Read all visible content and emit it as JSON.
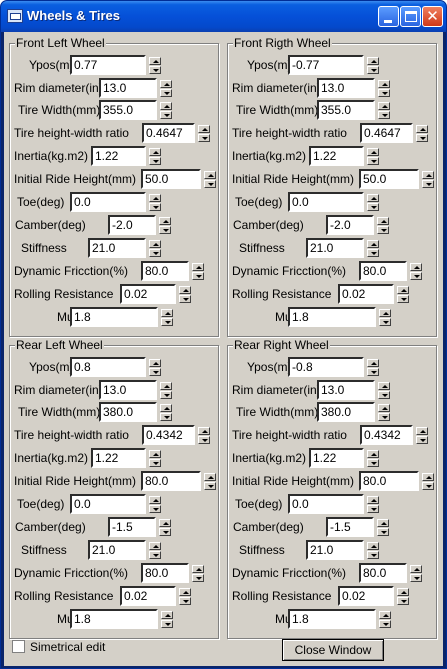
{
  "window": {
    "title": "Wheels & Tires",
    "icons": {
      "app": "window-app-icon",
      "minimize": "minimize-icon",
      "maximize": "maximize-icon",
      "close": "close-icon"
    }
  },
  "groups": {
    "front_left": {
      "title": "Front Left Wheel",
      "fields": {
        "ypos": {
          "label": "Ypos(m)",
          "value": "0.77"
        },
        "rim": {
          "label": "Rim diameter(in)",
          "value": "13.0"
        },
        "tire_width": {
          "label": "Tire Width(mm)",
          "value": "355.0"
        },
        "ratio": {
          "label": "Tire height-width ratio",
          "value": "0.4647"
        },
        "inertia": {
          "label": "Inertia(kg.m2)",
          "value": "1.22"
        },
        "ride_height": {
          "label": "Initial Ride Height(mm)",
          "value": "50.0"
        },
        "toe": {
          "label": "Toe(deg)",
          "value": "0.0"
        },
        "camber": {
          "label": "Camber(deg)",
          "value": "-2.0"
        },
        "stiffness": {
          "label": "Stiffness",
          "value": "21.0"
        },
        "friction": {
          "label": "Dynamic Fricction(%)",
          "value": "80.0"
        },
        "rolling": {
          "label": "Rolling Resistance",
          "value": "0.02"
        },
        "mu": {
          "label": "Mu",
          "value": "1.8"
        }
      }
    },
    "front_right": {
      "title": "Front Rigth Wheel",
      "fields": {
        "ypos": {
          "label": "Ypos(m)",
          "value": "-0.77"
        },
        "rim": {
          "label": "Rim diameter(in)",
          "value": "13.0"
        },
        "tire_width": {
          "label": "Tire Width(mm)",
          "value": "355.0"
        },
        "ratio": {
          "label": "Tire height-width ratio",
          "value": "0.4647"
        },
        "inertia": {
          "label": "Inertia(kg.m2)",
          "value": "1.22"
        },
        "ride_height": {
          "label": "Initial Ride Height(mm)",
          "value": "50.0"
        },
        "toe": {
          "label": "Toe(deg)",
          "value": "0.0"
        },
        "camber": {
          "label": "Camber(deg)",
          "value": "-2.0"
        },
        "stiffness": {
          "label": "Stiffness",
          "value": "21.0"
        },
        "friction": {
          "label": "Dynamic Fricction(%)",
          "value": "80.0"
        },
        "rolling": {
          "label": "Rolling Resistance",
          "value": "0.02"
        },
        "mu": {
          "label": "Mu",
          "value": "1.8"
        }
      }
    },
    "rear_left": {
      "title": "Rear Left Wheel",
      "fields": {
        "ypos": {
          "label": "Ypos(m)",
          "value": "0.8"
        },
        "rim": {
          "label": "Rim diameter(in)",
          "value": "13.0"
        },
        "tire_width": {
          "label": "Tire Width(mm)",
          "value": "380.0"
        },
        "ratio": {
          "label": "Tire height-width ratio",
          "value": "0.4342"
        },
        "inertia": {
          "label": "Inertia(kg.m2)",
          "value": "1.22"
        },
        "ride_height": {
          "label": "Initial Ride Height(mm)",
          "value": "80.0"
        },
        "toe": {
          "label": "Toe(deg)",
          "value": "0.0"
        },
        "camber": {
          "label": "Camber(deg)",
          "value": "-1.5"
        },
        "stiffness": {
          "label": "Stiffness",
          "value": "21.0"
        },
        "friction": {
          "label": "Dynamic Fricction(%)",
          "value": "80.0"
        },
        "rolling": {
          "label": "Rolling Resistance",
          "value": "0.02"
        },
        "mu": {
          "label": "Mu",
          "value": "1.8"
        }
      }
    },
    "rear_right": {
      "title": "Rear Right Wheel",
      "fields": {
        "ypos": {
          "label": "Ypos(m)",
          "value": "-0.8"
        },
        "rim": {
          "label": "Rim diameter(in)",
          "value": "13.0"
        },
        "tire_width": {
          "label": "Tire Width(mm)",
          "value": "380.0"
        },
        "ratio": {
          "label": "Tire height-width ratio",
          "value": "0.4342"
        },
        "inertia": {
          "label": "Inertia(kg.m2)",
          "value": "1.22"
        },
        "ride_height": {
          "label": "Initial Ride Height(mm)",
          "value": "80.0"
        },
        "toe": {
          "label": "Toe(deg)",
          "value": "0.0"
        },
        "camber": {
          "label": "Camber(deg)",
          "value": "-1.5"
        },
        "stiffness": {
          "label": "Stiffness",
          "value": "21.0"
        },
        "friction": {
          "label": "Dynamic Fricction(%)",
          "value": "80.0"
        },
        "rolling": {
          "label": "Rolling Resistance",
          "value": "0.02"
        },
        "mu": {
          "label": "Mu",
          "value": "1.8"
        }
      }
    }
  },
  "footer": {
    "symmetrical_label": "Simetrical edit",
    "symmetrical_checked": false,
    "close_label": "Close Window"
  }
}
